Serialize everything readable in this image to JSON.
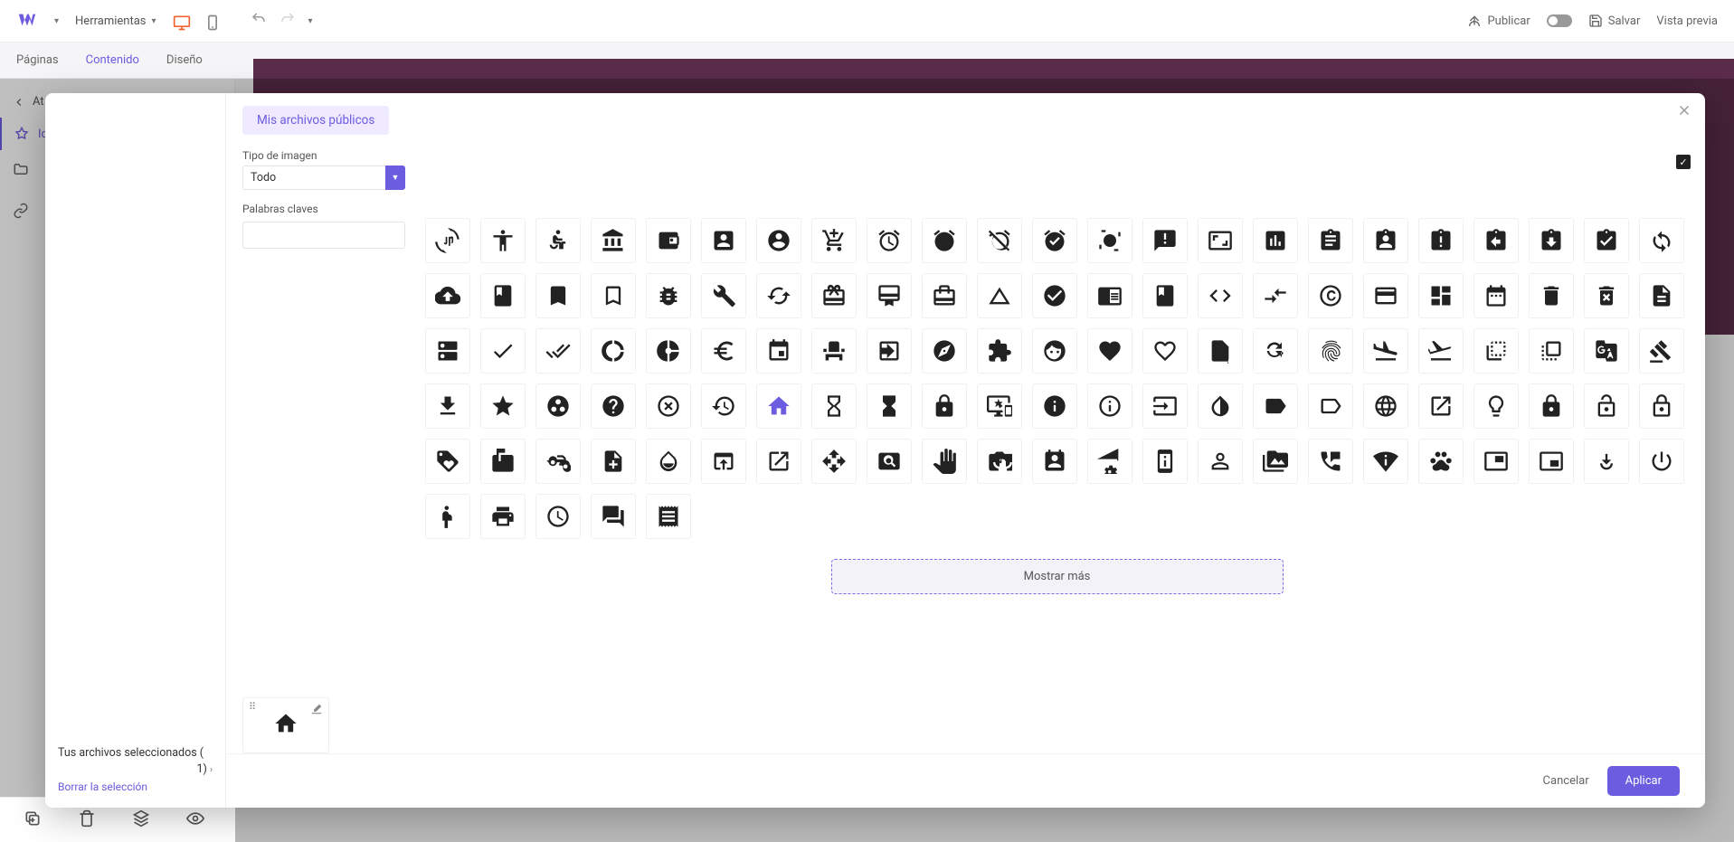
{
  "topbar": {
    "tools_label": "Herramientas",
    "publish_label": "Publicar",
    "save_label": "Salvar",
    "preview_label": "Vista previa"
  },
  "tabs": {
    "pages": "Páginas",
    "content": "Contenido",
    "design": "Diseño"
  },
  "sidebar": {
    "back_label": "At",
    "icon_label": "Icon"
  },
  "modal": {
    "selected_files_label": "Tus archivos seleccionados (",
    "selected_count": "1)",
    "clear_label": "Borrar la selección",
    "tab_public": "Mis archivos públicos",
    "image_type_label": "Tipo de imagen",
    "image_type_value": "Todo",
    "keywords_label": "Palabras claves",
    "show_more": "Mostrar más",
    "cancel": "Cancelar",
    "apply": "Aplicar"
  },
  "icons": [
    "3d-rotation",
    "accessibility",
    "accessible",
    "account-balance",
    "account-balance-wallet",
    "account-box",
    "account-circle",
    "add-shopping-cart",
    "alarm",
    "alarm-add",
    "alarm-off",
    "alarm-on",
    "all-out",
    "announcement",
    "aspect-ratio",
    "assessment",
    "assignment",
    "assignment-ind",
    "assignment-late",
    "assignment-return",
    "assignment-returned",
    "assignment-turned-in",
    "autorenew",
    "backup",
    "book",
    "bookmark",
    "bookmark-border",
    "bug-report",
    "build",
    "cached",
    "card-giftcard",
    "card-membership",
    "card-travel",
    "change-history",
    "check-circle",
    "chrome-reader-mode",
    "class",
    "code",
    "compare-arrows",
    "copyright",
    "credit-card",
    "dashboard",
    "date-range",
    "delete",
    "delete-forever",
    "description",
    "dns",
    "done",
    "done-all",
    "donut-large",
    "donut-small",
    "euro-symbol",
    "event",
    "event-seat",
    "exit-to-app",
    "explore",
    "extension",
    "face",
    "favorite",
    "favorite-border",
    "find-in-page",
    "find-replace",
    "fingerprint",
    "flight-land",
    "flight-takeoff",
    "flip-to-back",
    "flip-to-front",
    "g-translate",
    "gavel",
    "get-app",
    "grade",
    "group-work",
    "help",
    "highlight-off",
    "history",
    "home",
    "hourglass-empty",
    "hourglass-full",
    "https",
    "important-devices",
    "info",
    "info-outline",
    "input",
    "invert-colors",
    "label",
    "label-outline",
    "language",
    "launch",
    "lightbulb-outline",
    "lock",
    "lock-open",
    "lock-outline",
    "loyalty",
    "markunread-mailbox",
    "motorcycle",
    "note-add",
    "opacity",
    "open-in-browser",
    "open-in-new",
    "open-with",
    "pageview",
    "pan-tool",
    "perm-camera-mic",
    "perm-contact-calendar",
    "perm-data-setting",
    "perm-device-information",
    "perm-identity",
    "perm-media",
    "perm-phone-msg",
    "perm-scan-wifi",
    "pets",
    "picture-in-picture",
    "picture-in-picture-alt",
    "play-for-work",
    "power-settings-new",
    "pregnant-woman",
    "print",
    "query-builder",
    "question-answer",
    "receipt"
  ],
  "selected_icon": "home"
}
